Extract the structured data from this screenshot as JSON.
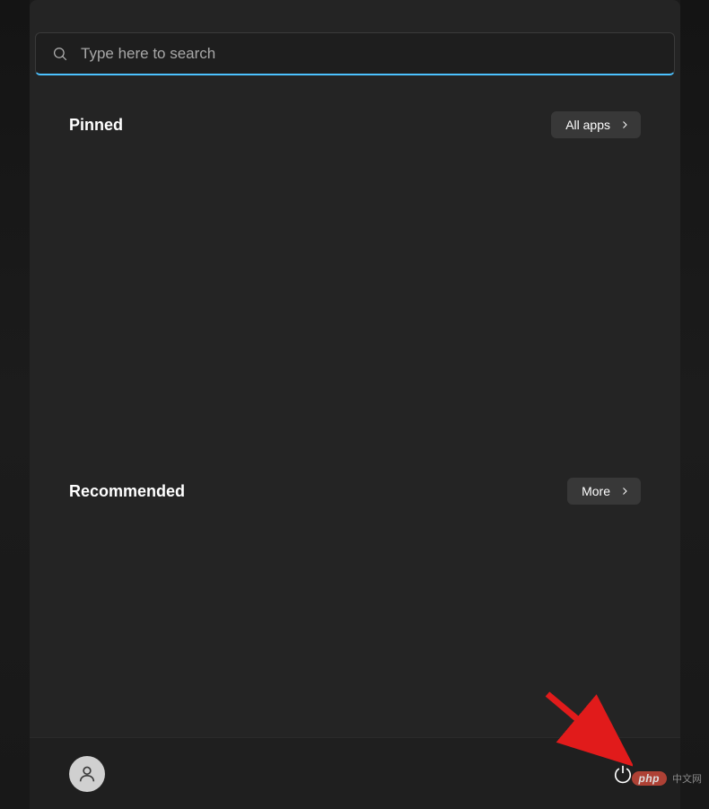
{
  "search": {
    "placeholder": "Type here to search"
  },
  "sections": {
    "pinned": {
      "title": "Pinned",
      "button_label": "All apps"
    },
    "recommended": {
      "title": "Recommended",
      "button_label": "More"
    }
  },
  "watermark": {
    "badge": "php",
    "text": "中文网"
  }
}
